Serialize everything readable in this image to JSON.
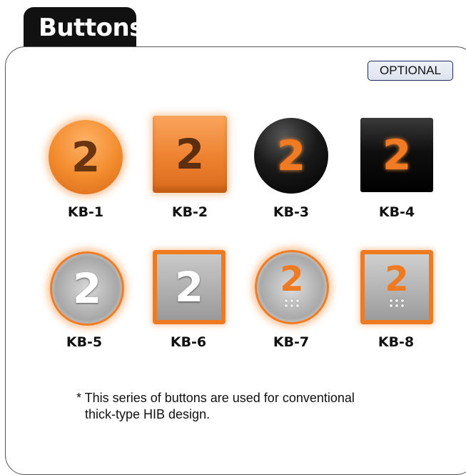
{
  "header": {
    "title": "Buttons"
  },
  "badge": {
    "label": "OPTIONAL"
  },
  "buttons": [
    {
      "id": "KB-1",
      "number": "2",
      "shape": "round",
      "finish": "orange"
    },
    {
      "id": "KB-2",
      "number": "2",
      "shape": "square",
      "finish": "orange"
    },
    {
      "id": "KB-3",
      "number": "2",
      "shape": "round",
      "finish": "black"
    },
    {
      "id": "KB-4",
      "number": "2",
      "shape": "square",
      "finish": "black"
    },
    {
      "id": "KB-5",
      "number": "2",
      "shape": "round",
      "finish": "steel-orange-ring"
    },
    {
      "id": "KB-6",
      "number": "2",
      "shape": "square",
      "finish": "steel-orange-frame"
    },
    {
      "id": "KB-7",
      "number": "2",
      "shape": "round",
      "finish": "steel-orange-ring-braille"
    },
    {
      "id": "KB-8",
      "number": "2",
      "shape": "square",
      "finish": "steel-orange-frame-braille"
    }
  ],
  "note": {
    "line1": "* This series of buttons are used for conventional",
    "line2": "thick-type HIB design."
  },
  "colors": {
    "accent": "#ee7a22",
    "dark": "#111111",
    "badge_border": "#1f2d5c"
  }
}
